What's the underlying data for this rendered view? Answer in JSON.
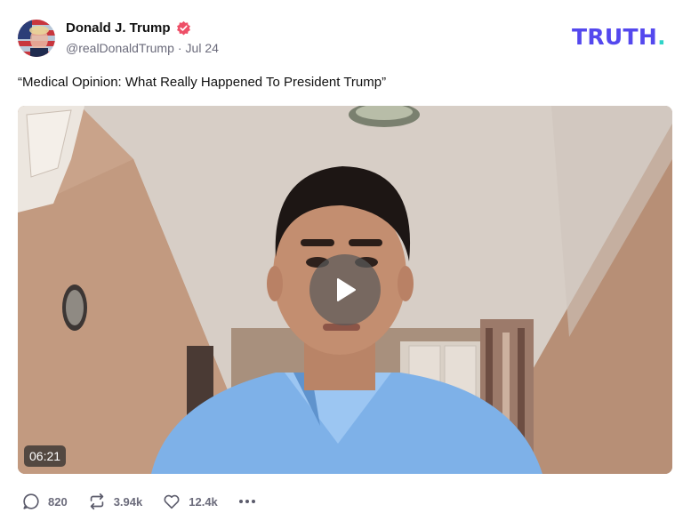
{
  "post": {
    "author": {
      "name": "Donald J. Trump",
      "handle": "@realDonaldTrump",
      "separator": "·",
      "date": "Jul 24",
      "verified_icon": "verified-badge-icon",
      "verified_color": "#ee4f67"
    },
    "brand": {
      "logo_text": "TRUTH",
      "logo_dot": ".",
      "logo_color": "#5448ee",
      "dot_color": "#2fd4c8"
    },
    "text": "“Medical Opinion: What Really Happened To President Trump”",
    "video": {
      "duration": "06:21",
      "play_icon": "play-icon"
    },
    "actions": {
      "replies": {
        "icon": "reply-icon",
        "count": "820"
      },
      "retruths": {
        "icon": "retruth-icon",
        "count": "3.94k"
      },
      "likes": {
        "icon": "heart-icon",
        "count": "12.4k"
      },
      "more": {
        "icon": "more-icon"
      }
    }
  }
}
